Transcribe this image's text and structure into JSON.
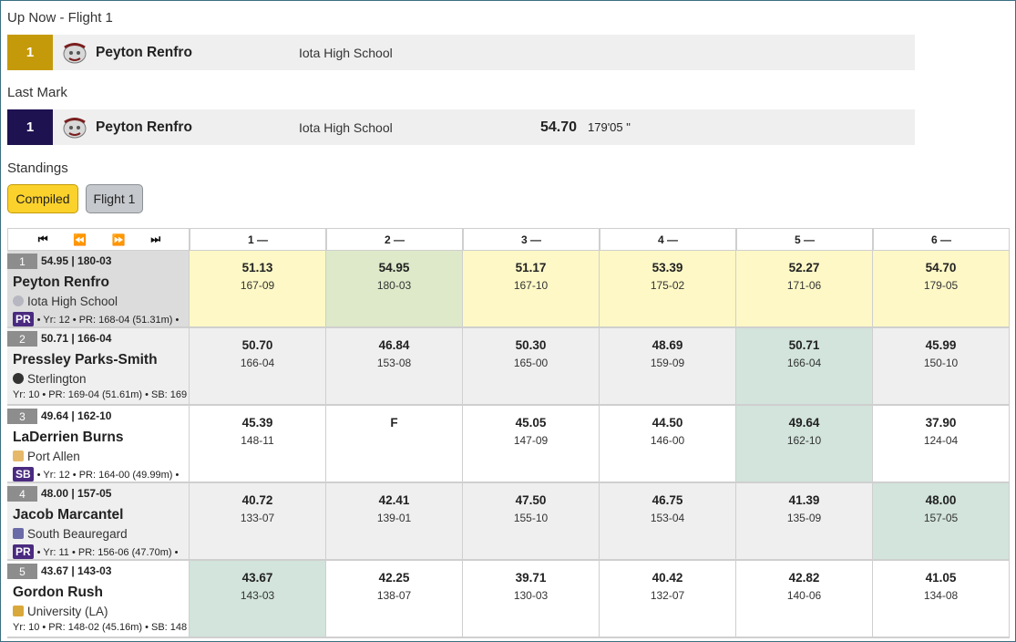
{
  "up_now": {
    "title": "Up Now - Flight 1",
    "position": "1",
    "name": "Peyton Renfro",
    "team": "Iota High School",
    "color": "#c59a0a"
  },
  "last_mark": {
    "title": "Last Mark",
    "position": "1",
    "name": "Peyton Renfro",
    "team": "Iota High School",
    "mark": "54.70",
    "imperial": "179'05 \"",
    "color": "#1e1250"
  },
  "standings": {
    "title": "Standings",
    "buttons": {
      "compiled": "Compiled",
      "flight1": "Flight 1"
    },
    "nav": {
      "first": "⏮",
      "prev": "⏪",
      "next": "⏩",
      "last": "⏭"
    },
    "attempt_headers": [
      "1 —",
      "2 —",
      "3 —",
      "4 —",
      "5 —",
      "6 —"
    ],
    "rows": [
      {
        "place": "1",
        "best": "54.95 | 180-03",
        "name": "Peyton Renfro",
        "school": "Iota High School",
        "badge": "PR",
        "meta": "• Yr: 12 • PR: 168-04 (51.31m) •",
        "marks": [
          {
            "m": "51.13",
            "f": "167-09"
          },
          {
            "m": "54.95",
            "f": "180-03"
          },
          {
            "m": "51.17",
            "f": "167-10"
          },
          {
            "m": "53.39",
            "f": "175-02"
          },
          {
            "m": "52.27",
            "f": "171-06"
          },
          {
            "m": "54.70",
            "f": "179-05"
          }
        ]
      },
      {
        "place": "2",
        "best": "50.71 | 166-04",
        "name": "Pressley Parks-Smith",
        "school": "Sterlington",
        "badge": "",
        "meta": "Yr: 10 • PR: 169-04 (51.61m) • SB: 169",
        "marks": [
          {
            "m": "50.70",
            "f": "166-04"
          },
          {
            "m": "46.84",
            "f": "153-08"
          },
          {
            "m": "50.30",
            "f": "165-00"
          },
          {
            "m": "48.69",
            "f": "159-09"
          },
          {
            "m": "50.71",
            "f": "166-04"
          },
          {
            "m": "45.99",
            "f": "150-10"
          }
        ]
      },
      {
        "place": "3",
        "best": "49.64 | 162-10",
        "name": "LaDerrien Burns",
        "school": "Port Allen",
        "badge": "SB",
        "meta": "• Yr: 12 • PR: 164-00 (49.99m) •",
        "marks": [
          {
            "m": "45.39",
            "f": "148-11"
          },
          {
            "m": "F",
            "f": ""
          },
          {
            "m": "45.05",
            "f": "147-09"
          },
          {
            "m": "44.50",
            "f": "146-00"
          },
          {
            "m": "49.64",
            "f": "162-10"
          },
          {
            "m": "37.90",
            "f": "124-04"
          }
        ]
      },
      {
        "place": "4",
        "best": "48.00 | 157-05",
        "name": "Jacob Marcantel",
        "school": "South Beauregard",
        "badge": "PR",
        "meta": "• Yr: 11 • PR: 156-06 (47.70m) •",
        "marks": [
          {
            "m": "40.72",
            "f": "133-07"
          },
          {
            "m": "42.41",
            "f": "139-01"
          },
          {
            "m": "47.50",
            "f": "155-10"
          },
          {
            "m": "46.75",
            "f": "153-04"
          },
          {
            "m": "41.39",
            "f": "135-09"
          },
          {
            "m": "48.00",
            "f": "157-05"
          }
        ]
      },
      {
        "place": "5",
        "best": "43.67 | 143-03",
        "name": "Gordon Rush",
        "school": "University (LA)",
        "badge": "",
        "meta": "Yr: 10 • PR: 148-02 (45.16m) • SB: 148",
        "marks": [
          {
            "m": "43.67",
            "f": "143-03"
          },
          {
            "m": "42.25",
            "f": "138-07"
          },
          {
            "m": "39.71",
            "f": "130-03"
          },
          {
            "m": "40.42",
            "f": "132-07"
          },
          {
            "m": "42.82",
            "f": "140-06"
          },
          {
            "m": "41.05",
            "f": "134-08"
          }
        ]
      }
    ]
  }
}
